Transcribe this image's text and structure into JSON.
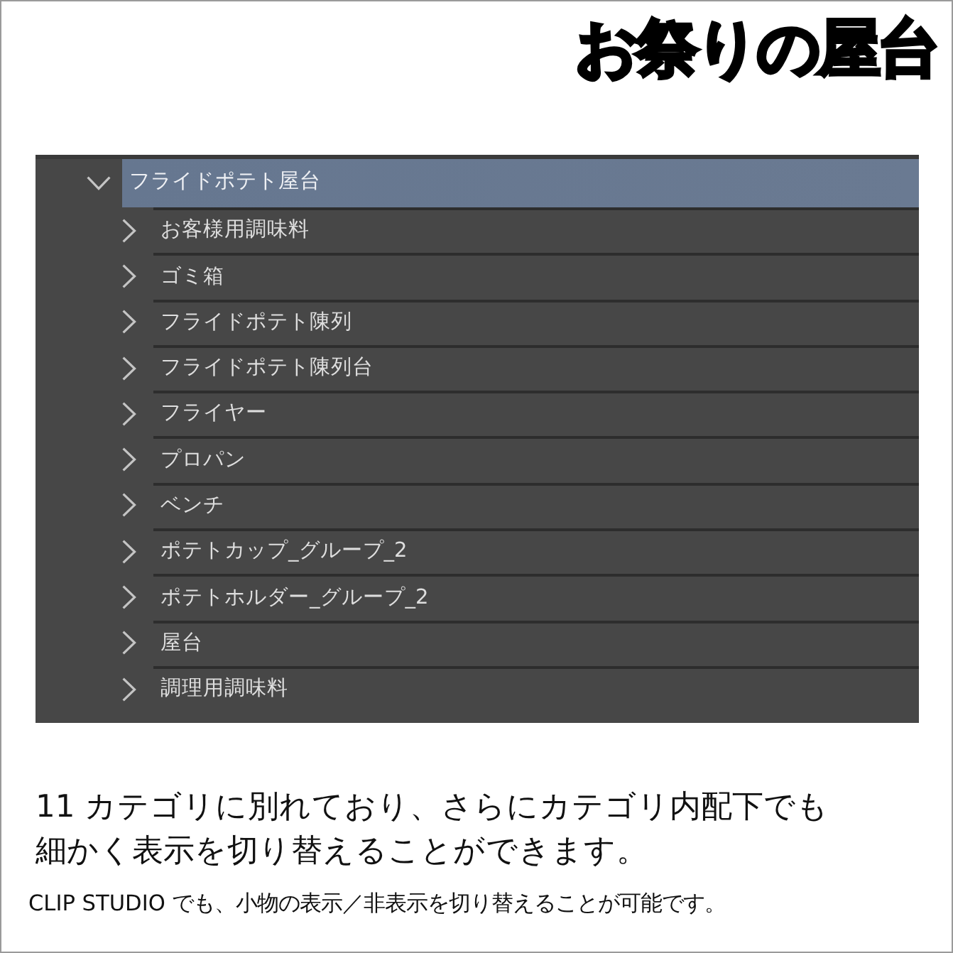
{
  "title": "お祭りの屋台",
  "tree": {
    "items": [
      {
        "label": "フライドポテト屋台",
        "expanded": true,
        "selected": true,
        "children": [
          {
            "label": "お客様用調味料",
            "expanded": false,
            "selected": false
          },
          {
            "label": "ゴミ箱",
            "expanded": false,
            "selected": false
          },
          {
            "label": "フライドポテト陳列",
            "expanded": false,
            "selected": false
          },
          {
            "label": "フライドポテト陳列台",
            "expanded": false,
            "selected": false
          },
          {
            "label": "フライヤー",
            "expanded": false,
            "selected": false
          },
          {
            "label": "プロパン",
            "expanded": false,
            "selected": false
          },
          {
            "label": "ベンチ",
            "expanded": false,
            "selected": false
          },
          {
            "label": "ポテトカップ_グループ_2",
            "expanded": false,
            "selected": false
          },
          {
            "label": "ポテトホルダー_グループ_2",
            "expanded": false,
            "selected": false
          },
          {
            "label": "屋台",
            "expanded": false,
            "selected": false
          },
          {
            "label": "調理用調味料",
            "expanded": false,
            "selected": false
          }
        ]
      }
    ]
  },
  "description": [
    "11 カテゴリに別れており、さらにカテゴリ内配下でも",
    "細かく表示を切り替えることができます。"
  ],
  "note": "CLIP STUDIO でも、小物の表示／非表示を切り替えることが可能です。"
}
